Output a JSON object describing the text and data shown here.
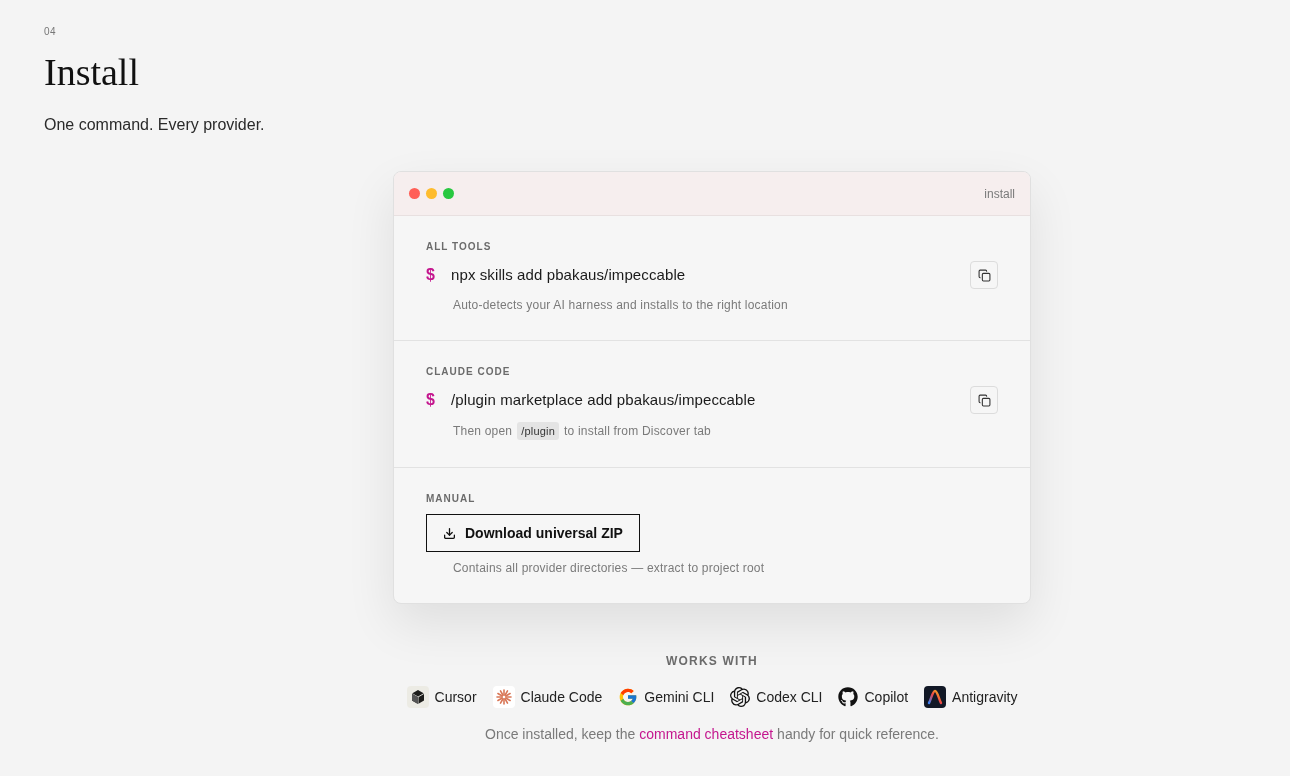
{
  "section": {
    "number": "04",
    "title": "Install",
    "subtitle": "One command. Every provider."
  },
  "terminal": {
    "title": "install",
    "blocks": [
      {
        "kind": "command",
        "label": "ALL TOOLS",
        "prompt": "$",
        "command": "npx skills add pbakaus/impeccable",
        "note": [
          {
            "kind": "text",
            "text": "Auto-detects your AI harness and installs to the right location"
          }
        ]
      },
      {
        "kind": "command",
        "label": "CLAUDE CODE",
        "prompt": "$",
        "command": "/plugin marketplace add pbakaus/impeccable",
        "note": [
          {
            "kind": "text",
            "text": "Then open"
          },
          {
            "kind": "code",
            "text": "/plugin"
          },
          {
            "kind": "text",
            "text": "to install from Discover tab"
          }
        ]
      },
      {
        "kind": "download",
        "label": "MANUAL",
        "button": "Download universal ZIP",
        "note": [
          {
            "kind": "text",
            "text": "Contains all provider directories — extract to project root"
          }
        ]
      }
    ]
  },
  "works_with": {
    "label": "WORKS WITH",
    "tools": [
      {
        "name": "Cursor"
      },
      {
        "name": "Claude Code"
      },
      {
        "name": "Gemini CLI"
      },
      {
        "name": "Codex CLI"
      },
      {
        "name": "Copilot"
      },
      {
        "name": "Antigravity"
      }
    ]
  },
  "footer": {
    "before": "Once installed, keep the",
    "link": "command cheatsheet",
    "after": "handy for quick reference."
  }
}
